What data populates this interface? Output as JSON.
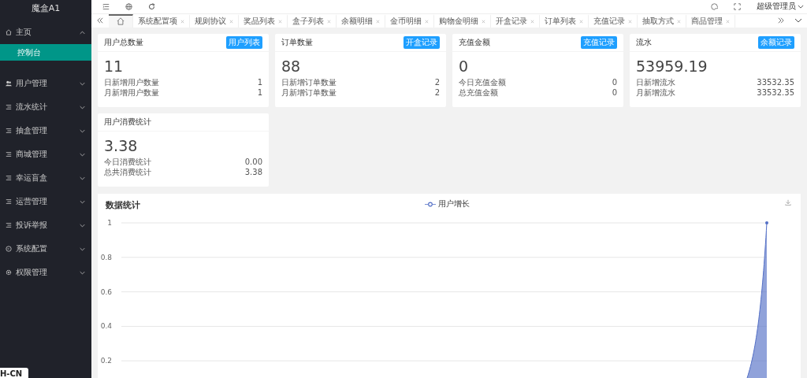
{
  "sidebar": {
    "logo": "魔盒A1",
    "items": [
      {
        "label": "主页",
        "expanded": true,
        "children": [
          {
            "label": "控制台",
            "selected": true
          }
        ]
      },
      {
        "label": "用户管理",
        "expanded": false
      },
      {
        "label": "流水统计",
        "expanded": false
      },
      {
        "label": "抽盒管理",
        "expanded": false
      },
      {
        "label": "商城管理",
        "expanded": false
      },
      {
        "label": "幸运盲盒",
        "expanded": false
      },
      {
        "label": "运营管理",
        "expanded": false
      },
      {
        "label": "投诉举报",
        "expanded": false
      },
      {
        "label": "系统配置",
        "expanded": false
      },
      {
        "label": "权限管理",
        "expanded": false
      }
    ],
    "language": "H-CN"
  },
  "header": {
    "user": "超级管理员"
  },
  "tabs": [
    {
      "kind": "home",
      "selected": true
    },
    {
      "label": "系统配置项",
      "kind": "page",
      "selected": false
    },
    {
      "label": "规则协议",
      "kind": "page",
      "selected": false
    },
    {
      "label": "奖品列表",
      "kind": "page",
      "selected": false
    },
    {
      "label": "盒子列表",
      "kind": "page",
      "selected": false
    },
    {
      "label": "余额明细",
      "kind": "page",
      "selected": false
    },
    {
      "label": "金币明细",
      "kind": "page",
      "selected": false
    },
    {
      "label": "购物金明细",
      "kind": "page",
      "selected": false
    },
    {
      "label": "开盒记录",
      "kind": "page",
      "selected": false
    },
    {
      "label": "订单列表",
      "kind": "page",
      "selected": false
    },
    {
      "label": "充值记录",
      "kind": "page",
      "selected": false
    },
    {
      "label": "抽取方式",
      "kind": "page",
      "selected": false
    },
    {
      "label": "商品管理",
      "kind": "page",
      "selected": false
    }
  ],
  "cards": [
    {
      "title": "用户总数量",
      "badge": "用户列表",
      "value": "11",
      "rows": [
        {
          "label": "日新增用户数量",
          "value": "1"
        },
        {
          "label": "月新增用户数量",
          "value": "1"
        }
      ]
    },
    {
      "title": "订单数量",
      "badge": "开盒记录",
      "value": "88",
      "rows": [
        {
          "label": "日新增订单数量",
          "value": "2"
        },
        {
          "label": "月新增订单数量",
          "value": "2"
        }
      ]
    },
    {
      "title": "充值金额",
      "badge": "充值记录",
      "value": "0",
      "rows": [
        {
          "label": "今日充值金额",
          "value": "0"
        },
        {
          "label": "总充值金额",
          "value": "0"
        }
      ]
    },
    {
      "title": "流水",
      "badge": "余额记录",
      "value": "53959.19",
      "rows": [
        {
          "label": "日新增流水",
          "value": "33532.35"
        },
        {
          "label": "月新增流水",
          "value": "33532.35"
        }
      ]
    },
    {
      "title": "用户消费统计",
      "value": "3.38",
      "rows": [
        {
          "label": "今日消费统计",
          "value": "0.00"
        },
        {
          "label": "总共消费统计",
          "value": "3.38"
        }
      ]
    }
  ],
  "stats": {
    "title": "数据统计",
    "legend": "用户增长",
    "y_labels": [
      "1",
      "0.8",
      "0.6",
      "0.4",
      "0.2"
    ]
  }
}
